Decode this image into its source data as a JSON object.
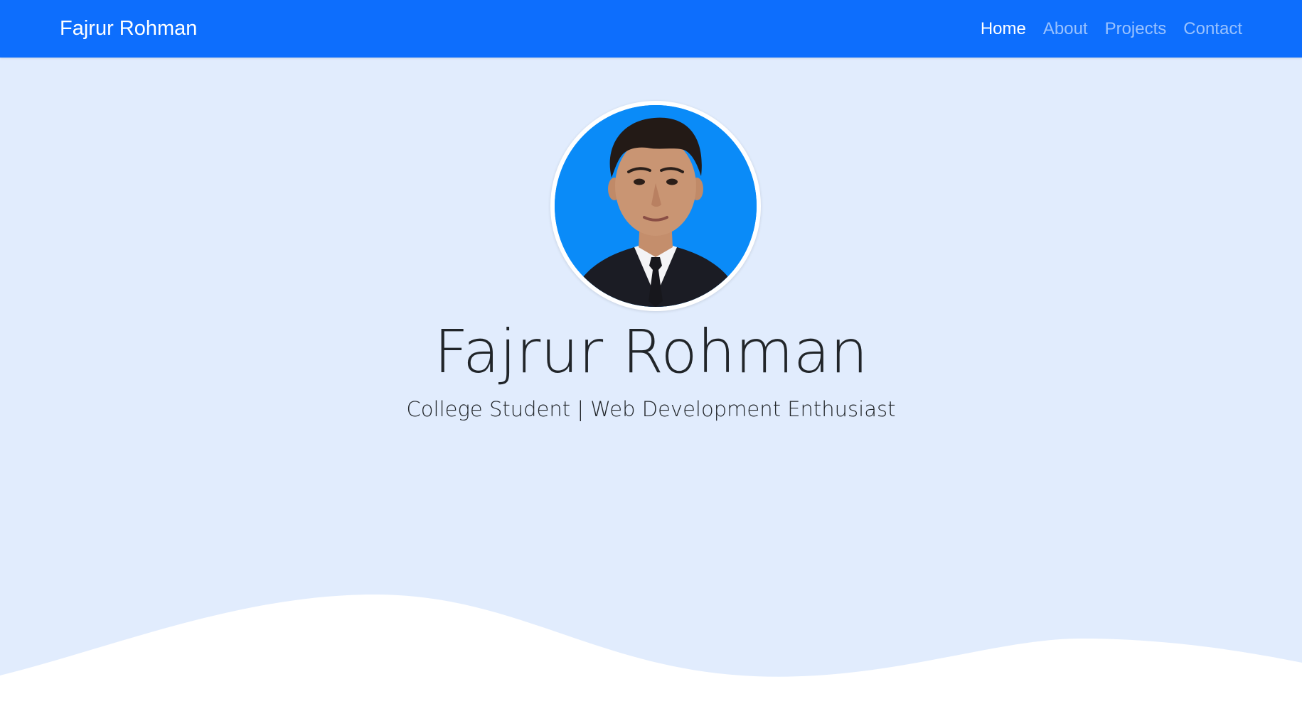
{
  "nav": {
    "brand": "Fajrur Rohman",
    "links": [
      {
        "label": "Home",
        "active": true
      },
      {
        "label": "About",
        "active": false
      },
      {
        "label": "Projects",
        "active": false
      },
      {
        "label": "Contact",
        "active": false
      }
    ]
  },
  "hero": {
    "name": "Fajrur Rohman",
    "subtitle": "College Student | Web Development Enthusiast",
    "avatar_icon": "profile-photo"
  },
  "colors": {
    "navbar": "#0d6efd",
    "hero_bg": "#e1ecfd",
    "wave": "#ffffff",
    "avatar_bg": "#0a8bf8"
  }
}
